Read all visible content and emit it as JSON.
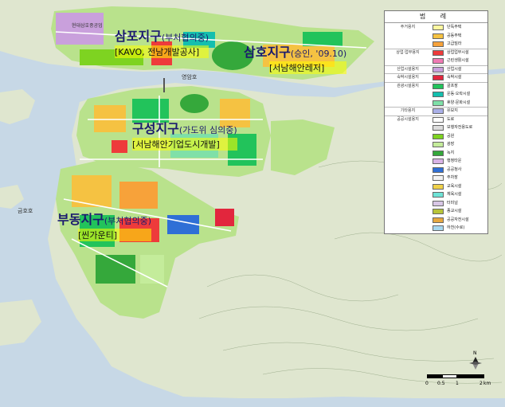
{
  "districts": {
    "sampo": {
      "name": "삼포지구",
      "status": "(부처협의중)",
      "sub": "[KAVO, 전남개발공사]"
    },
    "samho": {
      "name": "삼호지구",
      "status": "(승인, '09.10)",
      "sub": "[서남해안레저]"
    },
    "guseong": {
      "name": "구성지구",
      "status": "(가도위 심의중)",
      "sub": "[서남해안기업도시개발]"
    },
    "budong": {
      "name": "부동지구",
      "status": "(부처협의중)",
      "sub": "[씬가운티]"
    }
  },
  "place_labels": {
    "factory": "현대삼호중공업",
    "lake1": "영암호",
    "lake2": "금호호"
  },
  "legend": {
    "title": "범 례",
    "rows": [
      {
        "category": "주거용지",
        "label": "단독주택",
        "color": "#fff7a0"
      },
      {
        "category": "",
        "label": "공동주택",
        "color": "#f5c242"
      },
      {
        "category": "",
        "label": "고급빌라",
        "color": "#f7a23a"
      },
      {
        "category": "상업·업무용지",
        "label": "상업업무시설",
        "color": "#ee3b3b"
      },
      {
        "category": "",
        "label": "근린생활시설",
        "color": "#f07ab4"
      },
      {
        "category": "산업시설용지",
        "label": "산업시설",
        "color": "#c9a0dc"
      },
      {
        "category": "숙박시설용지",
        "label": "숙박시설",
        "color": "#e2263d"
      },
      {
        "category": "관광시설용지",
        "label": "골프장",
        "color": "#22c35b"
      },
      {
        "category": "",
        "label": "운동·오락시설",
        "color": "#14bfae"
      },
      {
        "category": "",
        "label": "휴양·문화시설",
        "color": "#7fe0a8"
      },
      {
        "category": "기타용지",
        "label": "유보지",
        "color": "#aab0e8"
      },
      {
        "category": "공공시설용지",
        "label": "도로",
        "color": "#ffffff"
      },
      {
        "category": "",
        "label": "보행자전용도로",
        "color": "#dcdcdc"
      },
      {
        "category": "",
        "label": "공원",
        "color": "#7ed321"
      },
      {
        "category": "",
        "label": "광장",
        "color": "#c4ec9b"
      },
      {
        "category": "",
        "label": "녹지",
        "color": "#35a83b"
      },
      {
        "category": "",
        "label": "행정타운",
        "color": "#d9b3e6"
      },
      {
        "category": "",
        "label": "공공청사",
        "color": "#2f6fd6"
      },
      {
        "category": "",
        "label": "주차장",
        "color": "#f3f3f3"
      },
      {
        "category": "",
        "label": "교육시설",
        "color": "#f0d24a"
      },
      {
        "category": "",
        "label": "체육시설",
        "color": "#6fe3d6"
      },
      {
        "category": "",
        "label": "터미널",
        "color": "#d8c6e6"
      },
      {
        "category": "",
        "label": "종교시설",
        "color": "#b7c43a"
      },
      {
        "category": "",
        "label": "공공자전시설",
        "color": "#e6a840"
      },
      {
        "category": "",
        "label": "하천(수로)",
        "color": "#a6d8f0"
      }
    ]
  },
  "scale": {
    "ticks": [
      "0",
      "0.5",
      "1",
      "2"
    ],
    "unit": "km"
  },
  "north": "N",
  "colors": {
    "water": "#c7d8e6",
    "land": "#dfe6cf"
  }
}
